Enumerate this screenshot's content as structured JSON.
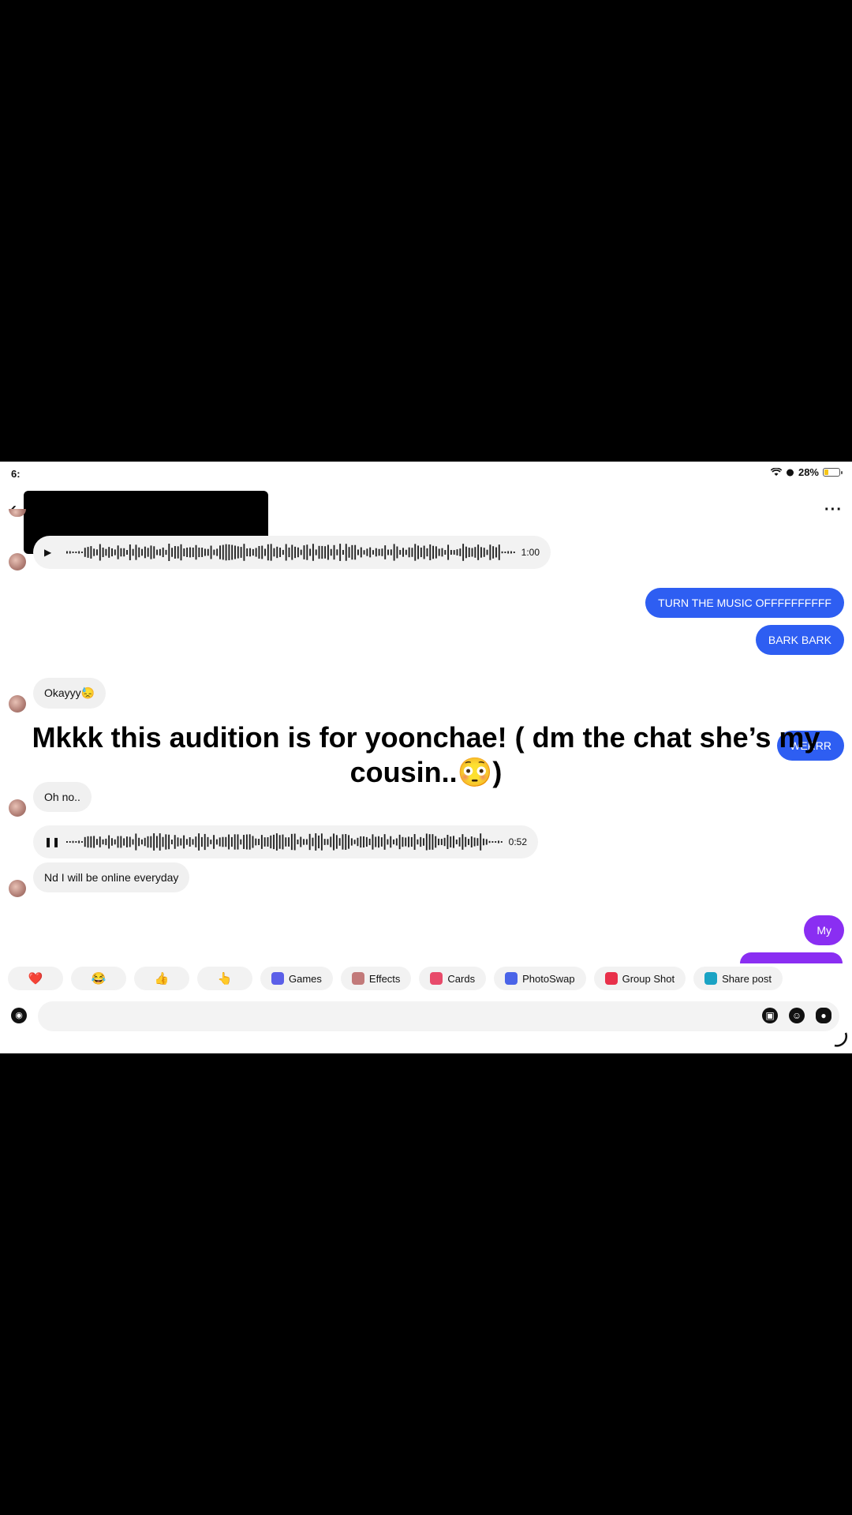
{
  "status": {
    "time": "6:",
    "battery": "28%",
    "battery_level": 0.28
  },
  "header": {
    "back_icon": "chevron-left-icon",
    "more_icon": "more-icon"
  },
  "messages": {
    "audio1_duration": "1:00",
    "out1": "TURN THE MUSIC OFFFFFFFFFF",
    "out2": "BARK BARK",
    "in1": "Okayyy😓",
    "out3_partial": "WERRR",
    "in2": "Oh no..",
    "audio2_duration": "0:52",
    "in3": "Nd I will be online everyday",
    "out4": "My"
  },
  "overlay": {
    "caption_line1": "Mkkk this audition is for yoonchae! ( dm the chat she’s my",
    "caption_line2": "cousin..😳)"
  },
  "quick_actions": {
    "emojis": [
      "❤️",
      "😂",
      "👍",
      "👆"
    ],
    "games": "Games",
    "effects": "Effects",
    "cards": "Cards",
    "photoswap": "PhotoSwap",
    "group_shot": "Group Shot",
    "share_post": "Share post"
  },
  "colors": {
    "outgoing_blue": "#2e5ef2",
    "outgoing_purple": "#8a2ef2",
    "incoming_gray": "#f0f0f0"
  }
}
